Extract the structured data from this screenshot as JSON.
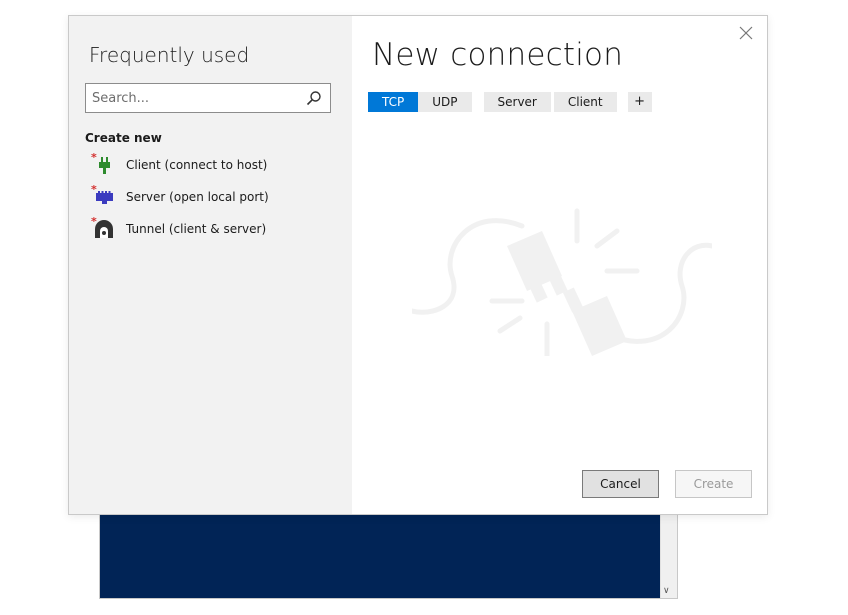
{
  "left": {
    "title": "Frequently used",
    "search_placeholder": "Search...",
    "create_new_label": "Create new",
    "items": [
      {
        "label": "Client (connect to host)",
        "icon": "plug-icon",
        "color": "#2e8b2e"
      },
      {
        "label": "Server (open local port)",
        "icon": "network-port-icon",
        "color": "#3b3bbf"
      },
      {
        "label": "Tunnel (client & server)",
        "icon": "tunnel-icon",
        "color": "#333333"
      }
    ]
  },
  "main": {
    "title": "New connection",
    "tabs": [
      {
        "label": "TCP",
        "active": true
      },
      {
        "label": "UDP",
        "active": false
      },
      {
        "label": "Server",
        "active": false
      },
      {
        "label": "Client",
        "active": false
      }
    ],
    "add_tab_label": "+",
    "illustration_icon": "unplugged-cable-icon"
  },
  "buttons": {
    "cancel_label": "Cancel",
    "create_label": "Create",
    "create_enabled": false
  },
  "colors": {
    "accent": "#0078d7",
    "terminal_background": "#012456",
    "new_item_marker": "#d3302f"
  }
}
